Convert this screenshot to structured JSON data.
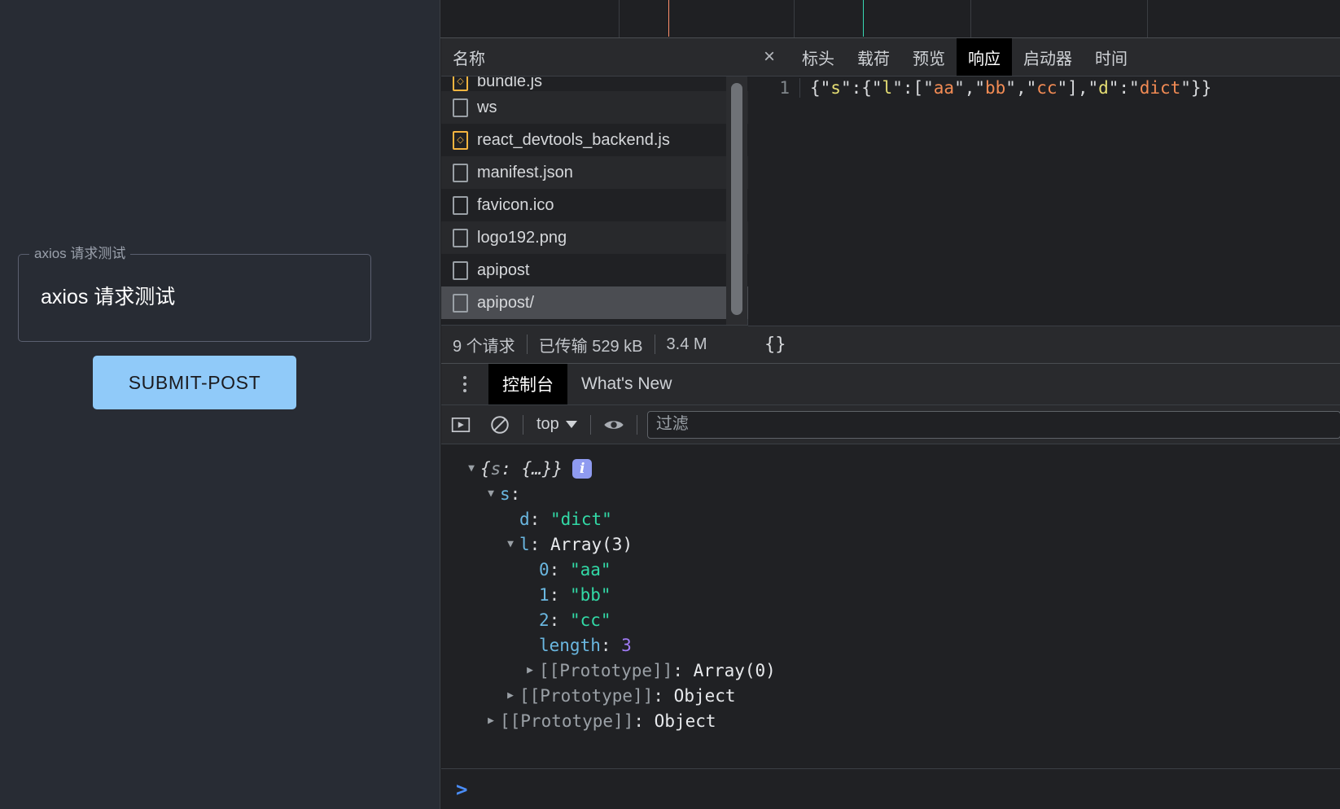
{
  "page": {
    "fieldset_legend": "axios 请求测试",
    "field_value": "axios 请求测试",
    "submit_label": "SUBMIT-POST"
  },
  "colors": {
    "accent_button": "#90caf9",
    "dcl_marker": "#ff8f6b",
    "load_marker": "#38d9b4",
    "active_tab_bg": "#000000",
    "info_badge": "#8f9bf0"
  },
  "network": {
    "column_header": "名称",
    "requests": [
      {
        "name": "bundle.js",
        "icon": "js-file-icon",
        "clipped": true,
        "selected": false
      },
      {
        "name": "ws",
        "icon": "generic-file-icon",
        "clipped": false,
        "selected": false
      },
      {
        "name": "react_devtools_backend.js",
        "icon": "js-file-icon",
        "clipped": false,
        "selected": false
      },
      {
        "name": "manifest.json",
        "icon": "generic-file-icon",
        "clipped": false,
        "selected": false
      },
      {
        "name": "favicon.ico",
        "icon": "generic-file-icon",
        "clipped": false,
        "selected": false
      },
      {
        "name": "logo192.png",
        "icon": "generic-file-icon",
        "clipped": false,
        "selected": false
      },
      {
        "name": "apipost",
        "icon": "generic-file-icon",
        "clipped": false,
        "selected": false
      },
      {
        "name": "apipost/",
        "icon": "generic-file-icon",
        "clipped": false,
        "selected": true
      }
    ],
    "status": {
      "requests": "9 个请求",
      "transferred": "已传输 529 kB",
      "resources": "3.4 M"
    }
  },
  "detail": {
    "close_label": "×",
    "tabs": [
      {
        "label": "标头",
        "active": false
      },
      {
        "label": "载荷",
        "active": false
      },
      {
        "label": "预览",
        "active": false
      },
      {
        "label": "响应",
        "active": true
      },
      {
        "label": "启动器",
        "active": false
      },
      {
        "label": "时间",
        "active": false
      }
    ],
    "response": {
      "line_number": "1",
      "raw": "{\"s\":{\"l\":[\"aa\",\"bb\",\"cc\"],\"d\":\"dict\"}}",
      "tokens": [
        {
          "t": "{\"",
          "c": "punc"
        },
        {
          "t": "s",
          "c": "key"
        },
        {
          "t": "\":{\"",
          "c": "punc"
        },
        {
          "t": "l",
          "c": "key"
        },
        {
          "t": "\":[\"",
          "c": "punc"
        },
        {
          "t": "aa",
          "c": "str"
        },
        {
          "t": "\",\"",
          "c": "punc"
        },
        {
          "t": "bb",
          "c": "str"
        },
        {
          "t": "\",\"",
          "c": "punc"
        },
        {
          "t": "cc",
          "c": "str"
        },
        {
          "t": "\"],\"",
          "c": "punc"
        },
        {
          "t": "d",
          "c": "key"
        },
        {
          "t": "\":\"",
          "c": "punc"
        },
        {
          "t": "dict",
          "c": "str"
        },
        {
          "t": "\"}}",
          "c": "punc"
        }
      ]
    },
    "pretty_print_label": "{}"
  },
  "drawer": {
    "tabs": [
      {
        "label": "控制台",
        "active": true
      },
      {
        "label": "What's New",
        "active": false
      }
    ],
    "toolbar": {
      "execution_context": "top",
      "filter_placeholder": "过滤"
    },
    "console_lines": [
      {
        "indent": 0,
        "disclosure": "open",
        "kind": "preview",
        "text": "{s: {…}}",
        "badge": "i"
      },
      {
        "indent": 1,
        "disclosure": "open",
        "kind": "prop",
        "key": "s",
        "value": "",
        "vtype": "none"
      },
      {
        "indent": 2,
        "disclosure": "none",
        "kind": "prop",
        "key": "d",
        "value": "\"dict\"",
        "vtype": "string"
      },
      {
        "indent": 2,
        "disclosure": "open",
        "kind": "prop",
        "key": "l",
        "value": "Array(3)",
        "vtype": "plain"
      },
      {
        "indent": 3,
        "disclosure": "none",
        "kind": "prop",
        "key": "0",
        "value": "\"aa\"",
        "vtype": "string"
      },
      {
        "indent": 3,
        "disclosure": "none",
        "kind": "prop",
        "key": "1",
        "value": "\"bb\"",
        "vtype": "string"
      },
      {
        "indent": 3,
        "disclosure": "none",
        "kind": "prop",
        "key": "2",
        "value": "\"cc\"",
        "vtype": "string"
      },
      {
        "indent": 3,
        "disclosure": "none",
        "kind": "prop",
        "key": "length",
        "value": "3",
        "vtype": "number"
      },
      {
        "indent": 3,
        "disclosure": "closed",
        "kind": "proto",
        "key": "[[Prototype]]",
        "value": "Array(0)",
        "vtype": "plain"
      },
      {
        "indent": 2,
        "disclosure": "closed",
        "kind": "proto",
        "key": "[[Prototype]]",
        "value": "Object",
        "vtype": "plain"
      },
      {
        "indent": 1,
        "disclosure": "closed",
        "kind": "proto",
        "key": "[[Prototype]]",
        "value": "Object",
        "vtype": "plain"
      }
    ],
    "prompt_caret": ">"
  }
}
